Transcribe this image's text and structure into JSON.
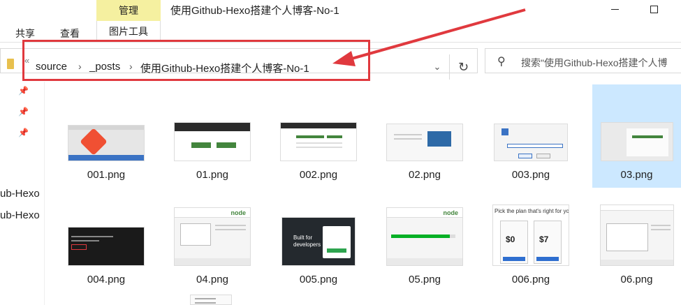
{
  "ribbon": {
    "contextual_tab": "管理",
    "tabs": [
      "共享",
      "查看",
      "图片工具"
    ]
  },
  "window": {
    "title": "使用Github-Hexo搭建个人博客-No-1"
  },
  "address": {
    "lead_glyph": "«",
    "crumbs": [
      "source",
      "_posts",
      "使用Github-Hexo搭建个人博客-No-1"
    ],
    "separator": "›",
    "dropdown_glyph": "⌄",
    "refresh_glyph": "↻"
  },
  "search": {
    "placeholder": "搜索\"使用Github-Hexo搭建个人博"
  },
  "nav_pane": {
    "items": [
      "ub-Hexo",
      "ub-Hexo"
    ]
  },
  "files": [
    {
      "name": "001.png"
    },
    {
      "name": "01.png"
    },
    {
      "name": "002.png"
    },
    {
      "name": "02.png"
    },
    {
      "name": "003.png"
    },
    {
      "name": "03.png"
    },
    {
      "name": "004.png"
    },
    {
      "name": "04.png"
    },
    {
      "name": "005.png"
    },
    {
      "name": "05.png"
    },
    {
      "name": "006.png"
    },
    {
      "name": "06.png"
    }
  ],
  "thumb_text": {
    "plan_title": "Pick the plan that's right for you",
    "price_a": "$0",
    "price_b": "$7",
    "built_for": "Built for developers",
    "node": "node"
  },
  "colors": {
    "manage_tab": "#f5f0a0",
    "highlight": "#e0393e",
    "selection": "#cce8ff",
    "git_red": "#f05033",
    "node_green": "#43853d"
  }
}
